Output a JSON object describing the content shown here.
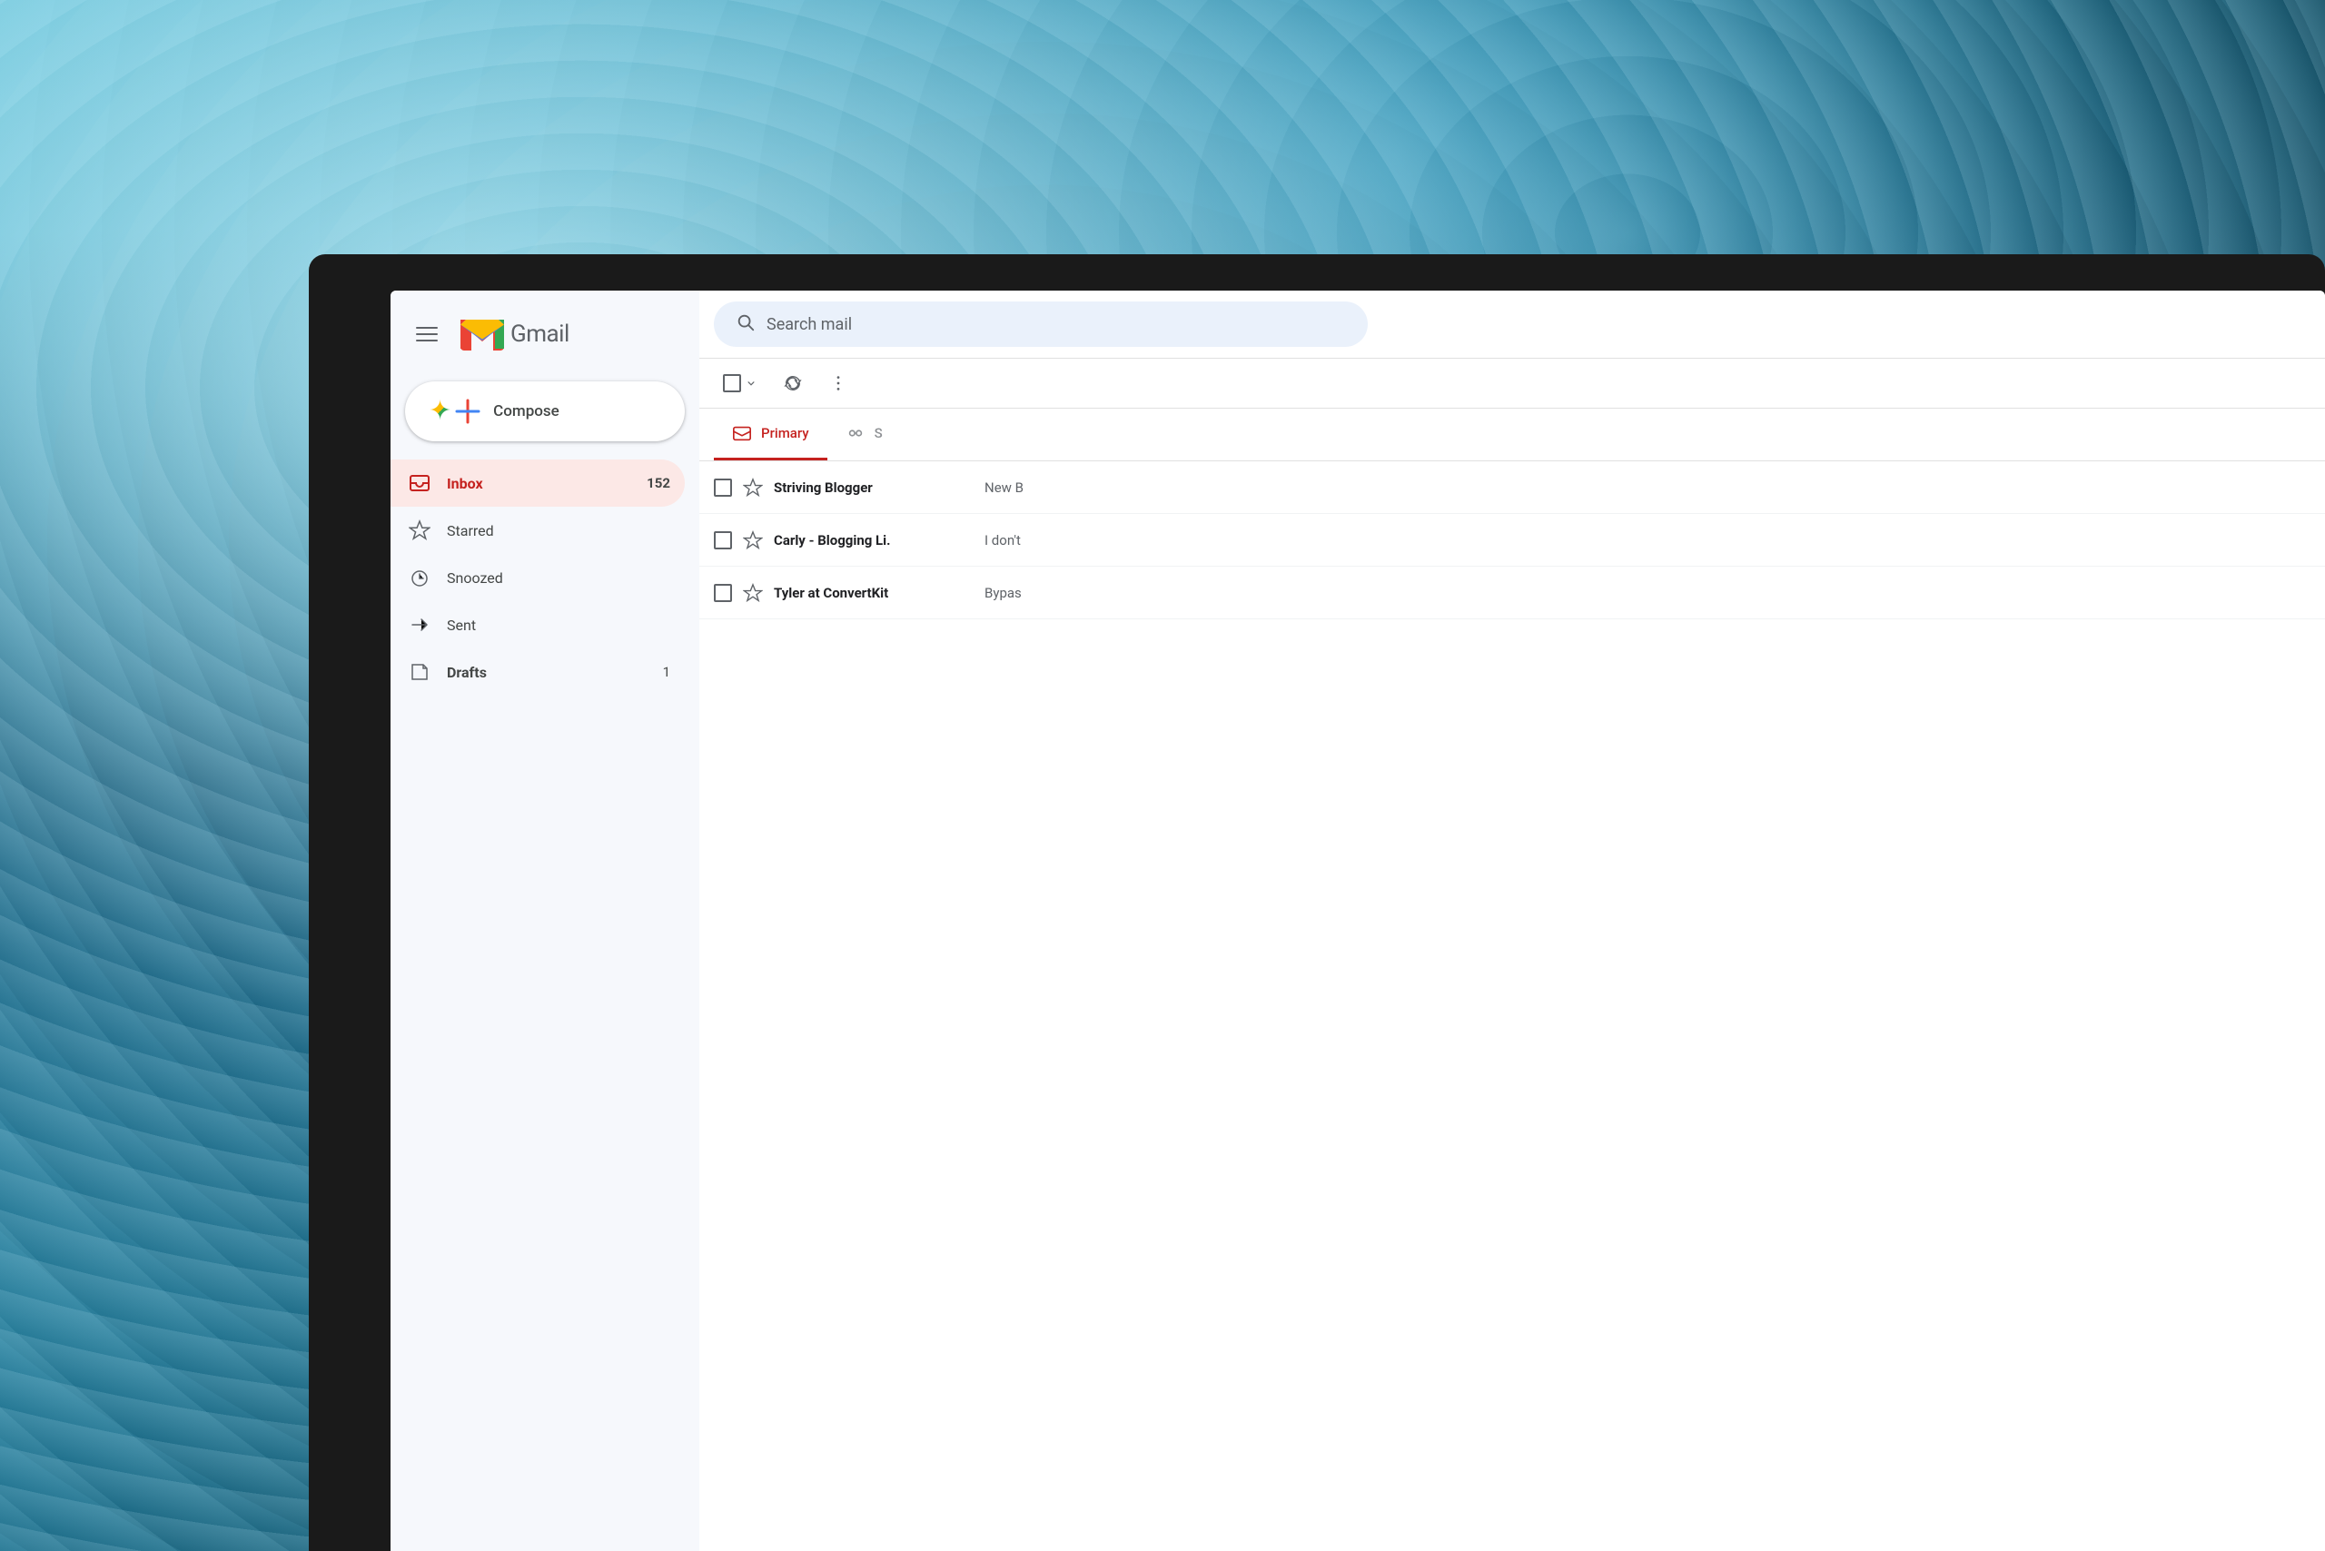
{
  "background": {
    "description": "Blurred teal blue abstract water/ice background"
  },
  "gmail_header": {
    "menu_label": "Main menu",
    "logo_text": "Gmail"
  },
  "compose": {
    "label": "Compose",
    "plus_symbol": "+"
  },
  "nav": {
    "items": [
      {
        "id": "inbox",
        "label": "Inbox",
        "count": "152",
        "active": true
      },
      {
        "id": "starred",
        "label": "Starred",
        "count": "",
        "active": false
      },
      {
        "id": "snoozed",
        "label": "Snoozed",
        "count": "",
        "active": false
      },
      {
        "id": "sent",
        "label": "Sent",
        "count": "",
        "active": false
      },
      {
        "id": "drafts",
        "label": "Drafts",
        "count": "1",
        "active": false
      }
    ]
  },
  "search": {
    "placeholder": "Search mail"
  },
  "toolbar": {
    "select_label": "Select",
    "refresh_label": "Refresh",
    "more_label": "More"
  },
  "tabs": [
    {
      "id": "primary",
      "label": "Primary",
      "active": true
    },
    {
      "id": "social",
      "label": "S",
      "active": false
    }
  ],
  "emails": [
    {
      "sender": "Striving Blogger",
      "preview": "New B",
      "starred": false
    },
    {
      "sender": "Carly - Blogging Li.",
      "preview": "I don't",
      "starred": false
    },
    {
      "sender": "Tyler at ConvertKit",
      "preview": "Bypas",
      "starred": false
    }
  ],
  "colors": {
    "gmail_red": "#c5221f",
    "gmail_blue": "#1a73e8",
    "gmail_green": "#34a853",
    "gmail_yellow": "#fbbc04",
    "active_nav_bg": "#fce8e6",
    "search_bg": "#eaf1fb",
    "sidebar_bg": "#f6f8fc"
  }
}
